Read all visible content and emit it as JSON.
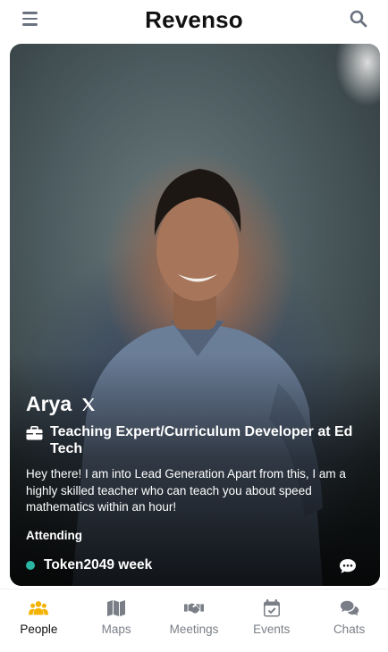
{
  "app": {
    "title": "Revenso"
  },
  "profile": {
    "name": "Arya",
    "job": "Teaching Expert/Curriculum Developer at Ed Tech",
    "bio": "Hey there! I am into Lead Generation Apart from this, I am a highly skilled teacher who can teach you about speed mathematics within an hour!",
    "attending_label": "Attending",
    "event": "Token2049 week"
  },
  "nav": {
    "items": [
      {
        "label": "People",
        "icon": "people-icon",
        "active": true
      },
      {
        "label": "Maps",
        "icon": "map-icon",
        "active": false
      },
      {
        "label": "Meetings",
        "icon": "handshake-icon",
        "active": false
      },
      {
        "label": "Events",
        "icon": "calendar-icon",
        "active": false
      },
      {
        "label": "Chats",
        "icon": "chat-bubbles-icon",
        "active": false
      }
    ]
  },
  "colors": {
    "accent": "#f5b301",
    "event_dot": "#2bb6a3",
    "nav_inactive": "#7a7f87"
  }
}
